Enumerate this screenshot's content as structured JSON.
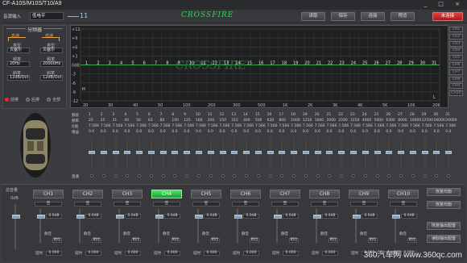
{
  "window": {
    "title": "CF-A10S/M10S/T10/A9",
    "controls": "_ □ ×"
  },
  "topbar": {
    "input_label": "音源输入",
    "input_value": "低电平",
    "meter_value": "11",
    "brand": "CROSSFIRE",
    "buttons": [
      "读取",
      "保存",
      "连接",
      "预览"
    ],
    "status": "未连接"
  },
  "crossover": {
    "title": "分频器",
    "highpass_label": "高通",
    "lowpass_label": "低通",
    "type_label": "类型",
    "hp_type": "贝塞尔",
    "lp_type": "贝塞尔",
    "freq_label": "频率",
    "hp_freq": "20Hz",
    "lp_freq": "20000Hz",
    "slope_label": "斜率",
    "hp_slope": "12dB/Oct",
    "lp_slope": "12dB/Oct"
  },
  "graph": {
    "y_ticks": [
      "+12",
      "+9",
      "+6",
      "+3",
      "0dB",
      "-3",
      "-6",
      "-9",
      "-12"
    ],
    "x_ticks": [
      "20",
      "30",
      "40",
      "50",
      "100",
      "200",
      "300",
      "500",
      "1K",
      "2K",
      "3K",
      "4K",
      "5K",
      "10K",
      "20K"
    ],
    "band_markers": [
      "1",
      "2",
      "3",
      "4",
      "5",
      "6",
      "7",
      "8",
      "9",
      "10",
      "11",
      "12",
      "13",
      "14",
      "15",
      "16",
      "17",
      "18",
      "19",
      "20",
      "21",
      "22",
      "23",
      "24",
      "25",
      "26",
      "27",
      "28",
      "29",
      "30",
      "31"
    ],
    "left_marker": "H",
    "right_marker": "L",
    "channel_buttons": [
      "CH1",
      "CH2",
      "CH3",
      "CH4",
      "CH5",
      "CH6",
      "CH7",
      "CH8",
      "CH9",
      "CH10"
    ]
  },
  "views": {
    "front": "前排",
    "rear": "后排",
    "all": "全部"
  },
  "eq": {
    "row_labels": {
      "band": "频段",
      "freq": "频率",
      "q": "Q值",
      "gain": "增益",
      "bypass": "直通"
    },
    "bands": [
      "1",
      "2",
      "3",
      "4",
      "5",
      "6",
      "7",
      "8",
      "9",
      "10",
      "11",
      "12",
      "13",
      "14",
      "15",
      "16",
      "17",
      "18",
      "19",
      "20",
      "21",
      "22",
      "23",
      "24",
      "25",
      "26",
      "27",
      "28",
      "29",
      "30",
      "31"
    ],
    "freqs": [
      "20",
      "25",
      "31",
      "40",
      "50",
      "63",
      "80",
      "100",
      "125",
      "160",
      "200",
      "250",
      "315",
      "400",
      "500",
      "630",
      "800",
      "1000",
      "1250",
      "1600",
      "2000",
      "2500",
      "3150",
      "4000",
      "5000",
      "6300",
      "8000",
      "10000",
      "12500",
      "16000",
      "20000"
    ],
    "qvalue": "7.566",
    "gain": "0.0",
    "slider_level": 0.5
  },
  "bottom": {
    "master_label": "总音量",
    "master_value": "0dB",
    "channels": [
      "CH1",
      "CH2",
      "CH3",
      "CH4",
      "CH5",
      "CH6",
      "CH7",
      "CH8",
      "CH9",
      "CH10"
    ],
    "active_channel": "CH4",
    "mode": "空",
    "ch_value": "0.0dB",
    "mute": "静音",
    "phase": "相位",
    "delay_label": "延时",
    "delay_value": "0.000",
    "right_buttons": [
      "恢复均衡",
      "恢复均衡",
      "恢复输出配置",
      "读取输出配置"
    ]
  },
  "watermark": "360汽车网 www.360qc.com"
}
